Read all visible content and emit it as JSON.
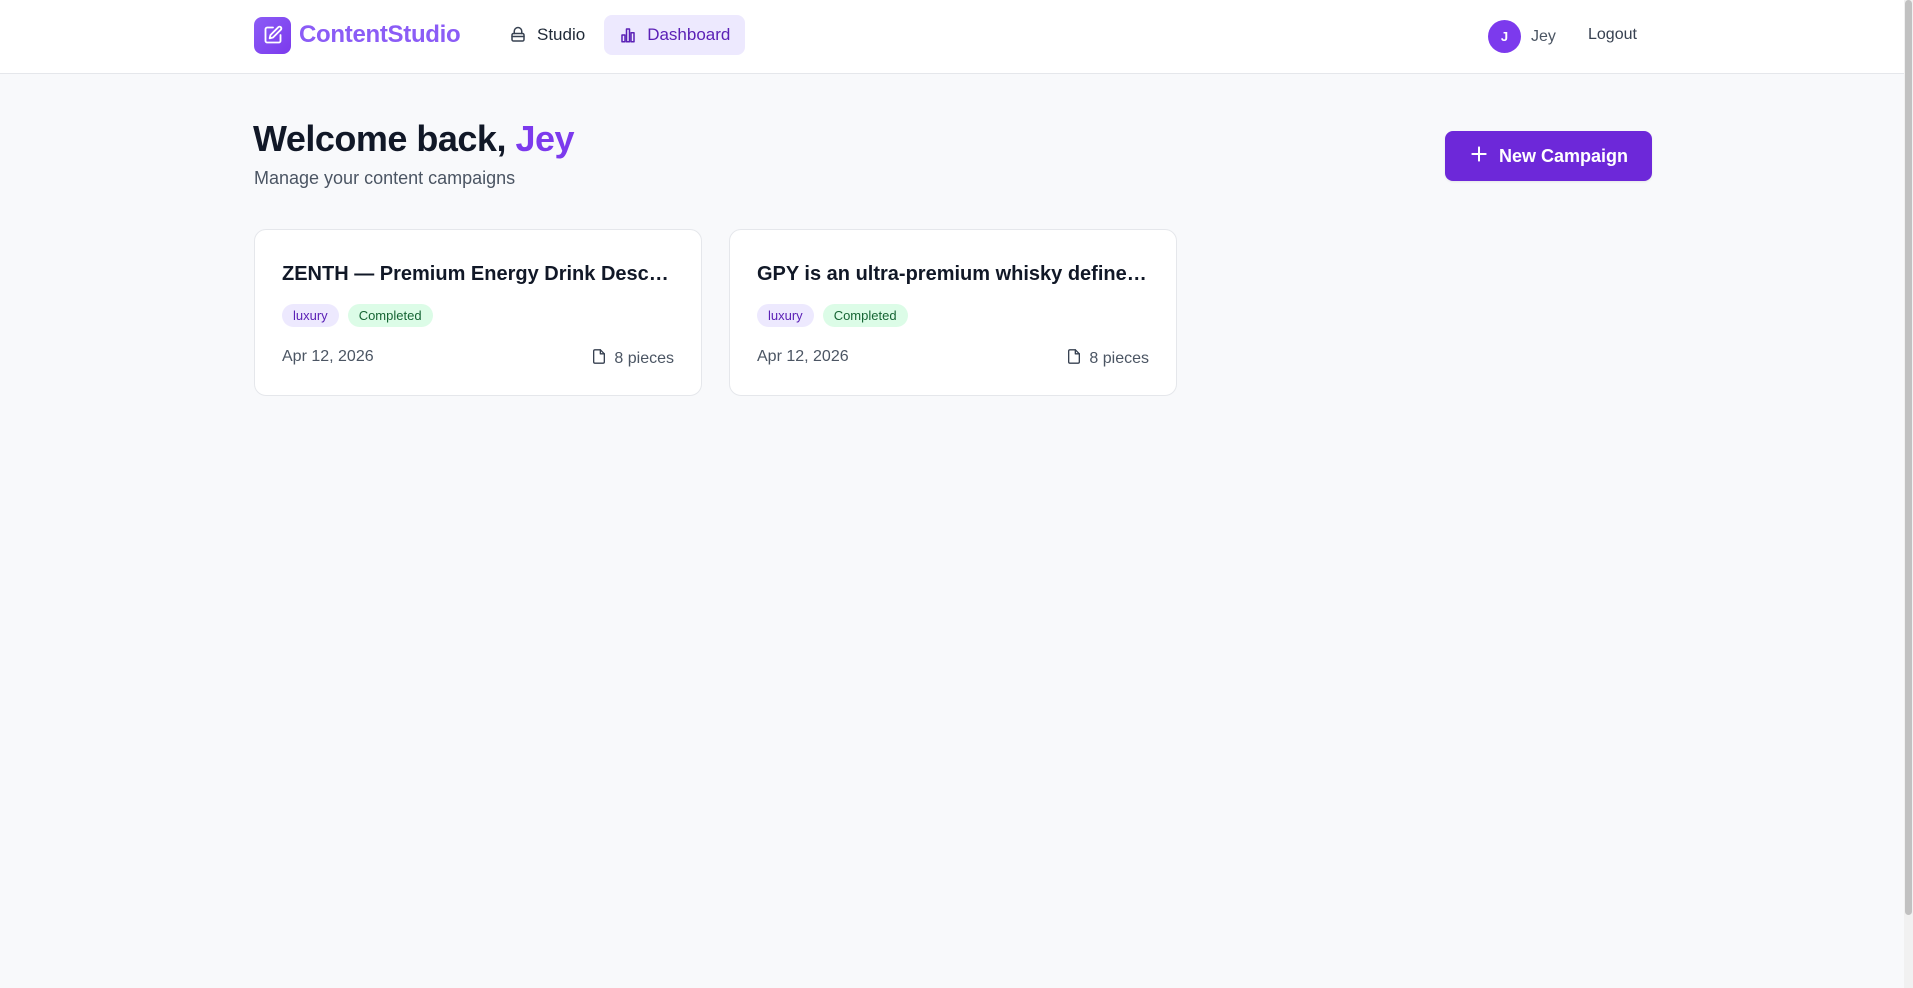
{
  "app": {
    "name": "ContentStudio",
    "brand_color": "#8b5cf6",
    "accent_color": "#6d28d9"
  },
  "nav": {
    "items": [
      {
        "label": "Studio",
        "icon": "studio-icon",
        "active": false
      },
      {
        "label": "Dashboard",
        "icon": "bar-chart-icon",
        "active": true
      }
    ]
  },
  "user": {
    "initial": "J",
    "name": "Jey",
    "logout_label": "Logout"
  },
  "page": {
    "welcome_prefix": "Welcome back,",
    "welcome_name": "Jey",
    "subtitle": "Manage your content campaigns",
    "new_campaign_label": "New Campaign"
  },
  "campaigns": [
    {
      "title": "ZENTH — Premium Energy Drink Description",
      "category": "luxury",
      "status": "Completed",
      "date": "Apr 12, 2026",
      "pieces": "8 pieces"
    },
    {
      "title": "GPY is an ultra-premium whisky defined by craftsmanship",
      "category": "luxury",
      "status": "Completed",
      "date": "Apr 12, 2026",
      "pieces": "8 pieces"
    }
  ]
}
